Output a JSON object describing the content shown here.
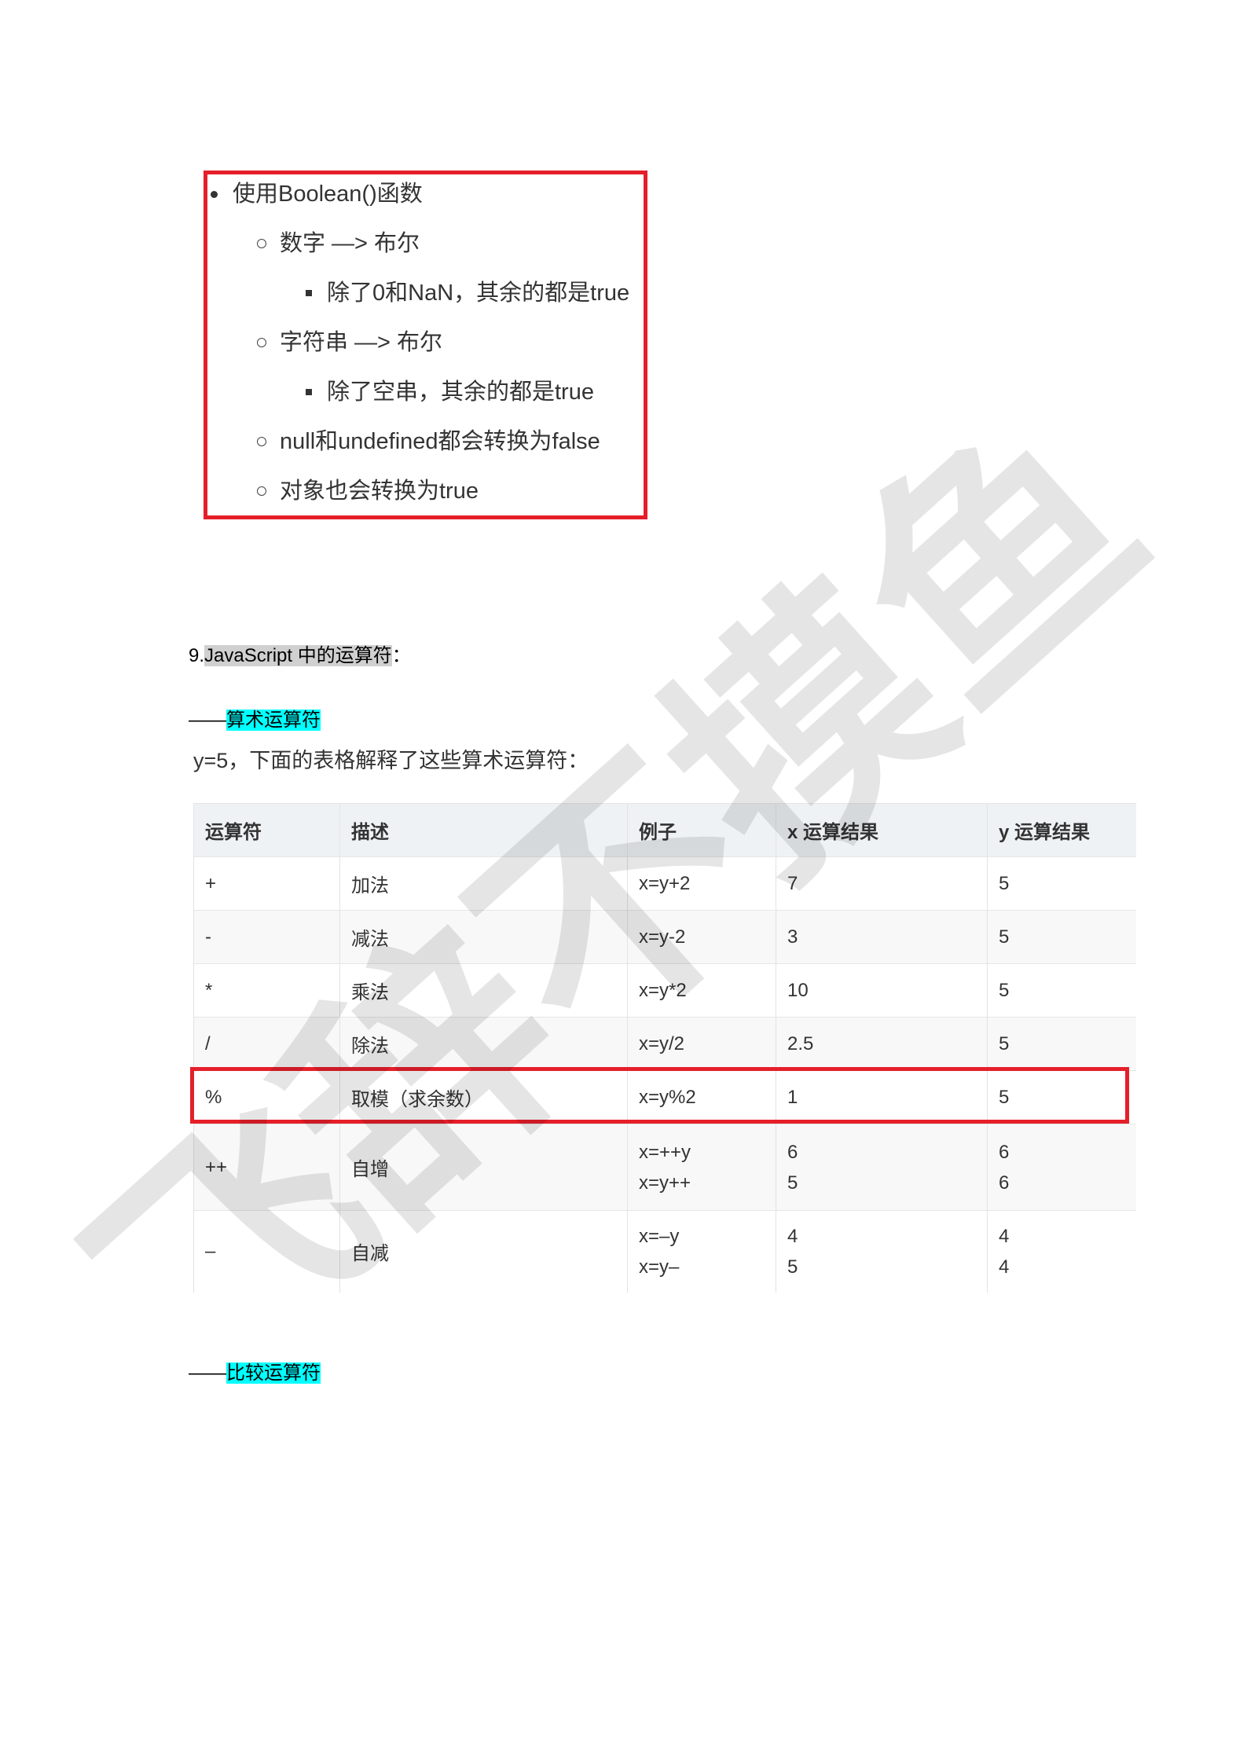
{
  "watermark": "飞辞不摸鱼",
  "colors": {
    "red_box": "#e51f2a",
    "highlight_cyan": "#00ffff",
    "highlight_gray": "#d0d0d0",
    "table_header_bg": "#eff2f5",
    "table_stripe_bg": "#f8f8f8",
    "text": "#333333"
  },
  "boolean_box": {
    "title": "使用Boolean()函数",
    "items": [
      {
        "label": "数字 —> 布尔",
        "children": [
          "除了0和NaN，其余的都是true"
        ]
      },
      {
        "label": "字符串 —> 布尔",
        "children": [
          "除了空串，其余的都是true"
        ]
      },
      {
        "label": "null和undefined都会转换为false"
      },
      {
        "label": "对象也会转换为true"
      }
    ]
  },
  "section9": {
    "prefix": "9.",
    "highlighted": "JavaScript 中的运算符",
    "suffix": "："
  },
  "arithmetic": {
    "dash": "——",
    "title": "算术运算符",
    "intro": "y=5，下面的表格解释了这些算术运算符："
  },
  "table": {
    "headers": [
      "运算符",
      "描述",
      "例子",
      "x 运算结果",
      "y 运算结果"
    ],
    "rows": [
      {
        "op": "+",
        "desc": "加法",
        "example": "x=y+2",
        "x": "7",
        "y": "5"
      },
      {
        "op": "-",
        "desc": "减法",
        "example": "x=y-2",
        "x": "3",
        "y": "5"
      },
      {
        "op": "*",
        "desc": "乘法",
        "example": "x=y*2",
        "x": "10",
        "y": "5"
      },
      {
        "op": "/",
        "desc": "除法",
        "example": "x=y/2",
        "x": "2.5",
        "y": "5"
      },
      {
        "op": "%",
        "desc": "取模（求余数）",
        "example": "x=y%2",
        "x": "1",
        "y": "5",
        "highlighted": true
      },
      {
        "op": "++",
        "desc": "自增",
        "example": [
          "x=++y",
          "x=y++"
        ],
        "x": [
          "6",
          "5"
        ],
        "y": [
          "6",
          "6"
        ]
      },
      {
        "op": "–",
        "desc": "自减",
        "example": [
          "x=–y",
          "x=y–"
        ],
        "x": [
          "4",
          "5"
        ],
        "y": [
          "4",
          "4"
        ]
      }
    ]
  },
  "comparison": {
    "dash": "——",
    "title": "比较运算符"
  }
}
